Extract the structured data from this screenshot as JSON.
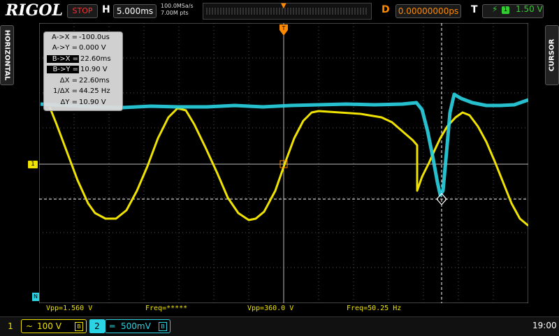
{
  "header": {
    "brand": "RIGOL",
    "run_status": "STOP",
    "timebase_label": "H",
    "timebase": "5.000ms",
    "sample_rate": "100.0MSa/s",
    "memory_depth": "7.00M pts",
    "delay_label": "D",
    "delay": "0.00000000ps",
    "trigger_label": "T",
    "trigger_source": "1",
    "trigger_level": "1.50 V"
  },
  "side_tabs": {
    "left": "HORIZONTAL",
    "right": "CURSOR"
  },
  "cursor_readout": [
    {
      "label": "A->X =",
      "value": "-100.0us",
      "highlight": false
    },
    {
      "label": "A->Y =",
      "value": "0.000 V",
      "highlight": false
    },
    {
      "label": "B->X =",
      "value": "22.60ms",
      "highlight": true
    },
    {
      "label": "B->Y =",
      "value": "10.90 V",
      "highlight": true
    },
    {
      "label": "ΔX =",
      "value": "22.60ms",
      "highlight": false
    },
    {
      "label": "1/ΔX =",
      "value": "44.25 Hz",
      "highlight": false
    },
    {
      "label": "ΔY =",
      "value": "10.90 V",
      "highlight": false
    }
  ],
  "measurements": {
    "ch1_vpp": "Vpp=1.560 V",
    "ch1_freq": "Freq=*****",
    "ch2_vpp": "Vpp=360.0 V",
    "ch2_freq": "Freq=50.25 Hz"
  },
  "channels": {
    "ch1": {
      "number": "1",
      "coupling_symbol": "~",
      "scale": "100 V",
      "color": "#f0e300"
    },
    "ch2": {
      "number": "2",
      "coupling_symbol": "═",
      "scale": "500mV",
      "color": "#2ad4e4"
    }
  },
  "markers": {
    "ch1_ground": "1",
    "trigger": "N"
  },
  "clock": "19:00",
  "colors": {
    "ch1": "#f0e300",
    "ch2": "#2ad4e4",
    "trigger": "#ff8a00",
    "stop": "#ff3030"
  }
}
